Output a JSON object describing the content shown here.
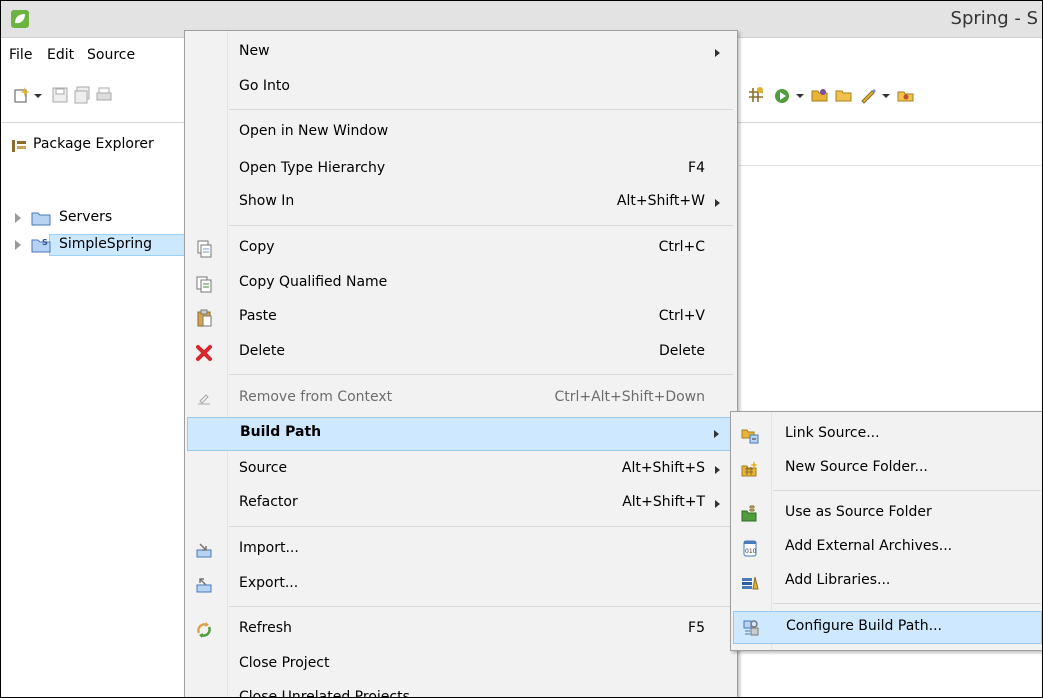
{
  "window": {
    "title": "Spring - S"
  },
  "menubar": {
    "items": [
      "File",
      "Edit",
      "Source"
    ]
  },
  "toolbar": {
    "icons": [
      "new-wizard-icon",
      "dropdown-arrow-icon",
      "save-icon",
      "save-all-icon",
      "print-icon",
      "open-type-icon",
      "run-icon",
      "open-folder-icon",
      "open-project-icon",
      "pen-icon",
      "open-archive-icon"
    ]
  },
  "package_explorer": {
    "title": "Package Explorer",
    "tree": [
      {
        "label": "Servers",
        "icon": "folder-icon"
      },
      {
        "label": "SimpleSpring",
        "icon": "spring-project-icon",
        "selected": true
      }
    ]
  },
  "context_menu": {
    "items": [
      {
        "label": "New",
        "submenu": true
      },
      {
        "label": "Go Into"
      },
      {
        "label": "Open in New Window"
      },
      {
        "label": "Open Type Hierarchy",
        "accel": "F4"
      },
      {
        "label": "Show In",
        "accel": "Alt+Shift+W",
        "submenu": true
      },
      {
        "label": "Copy",
        "accel": "Ctrl+C",
        "icon": "copy-icon"
      },
      {
        "label": "Copy Qualified Name",
        "icon": "copy-qualified-icon"
      },
      {
        "label": "Paste",
        "accel": "Ctrl+V",
        "icon": "paste-icon"
      },
      {
        "label": "Delete",
        "accel": "Delete",
        "icon": "delete-icon"
      },
      {
        "label": "Remove from Context",
        "accel": "Ctrl+Alt+Shift+Down",
        "icon": "remove-context-icon",
        "disabled": true
      },
      {
        "label": "Build Path",
        "submenu": true,
        "highlighted": true
      },
      {
        "label": "Source",
        "accel": "Alt+Shift+S",
        "submenu": true
      },
      {
        "label": "Refactor",
        "accel": "Alt+Shift+T",
        "submenu": true
      },
      {
        "label": "Import...",
        "icon": "import-icon"
      },
      {
        "label": "Export...",
        "icon": "export-icon"
      },
      {
        "label": "Refresh",
        "accel": "F5",
        "icon": "refresh-icon"
      },
      {
        "label": "Close Project"
      },
      {
        "label": "Close Unrelated Projects"
      }
    ]
  },
  "build_path_submenu": {
    "items": [
      {
        "label": "Link Source...",
        "icon": "link-source-icon"
      },
      {
        "label": "New Source Folder...",
        "icon": "new-source-folder-icon"
      },
      {
        "label": "Use as Source Folder",
        "icon": "use-source-folder-icon"
      },
      {
        "label": "Add External Archives...",
        "icon": "jar-icon"
      },
      {
        "label": "Add Libraries...",
        "icon": "libraries-icon"
      },
      {
        "label": "Configure Build Path...",
        "icon": "configure-build-path-icon",
        "highlighted": true
      }
    ]
  },
  "colors": {
    "highlight": "#cde8ff",
    "highlight_border": "#99c9ef",
    "menu_bg": "#f2f2f2",
    "delete_red": "#d9262c"
  }
}
